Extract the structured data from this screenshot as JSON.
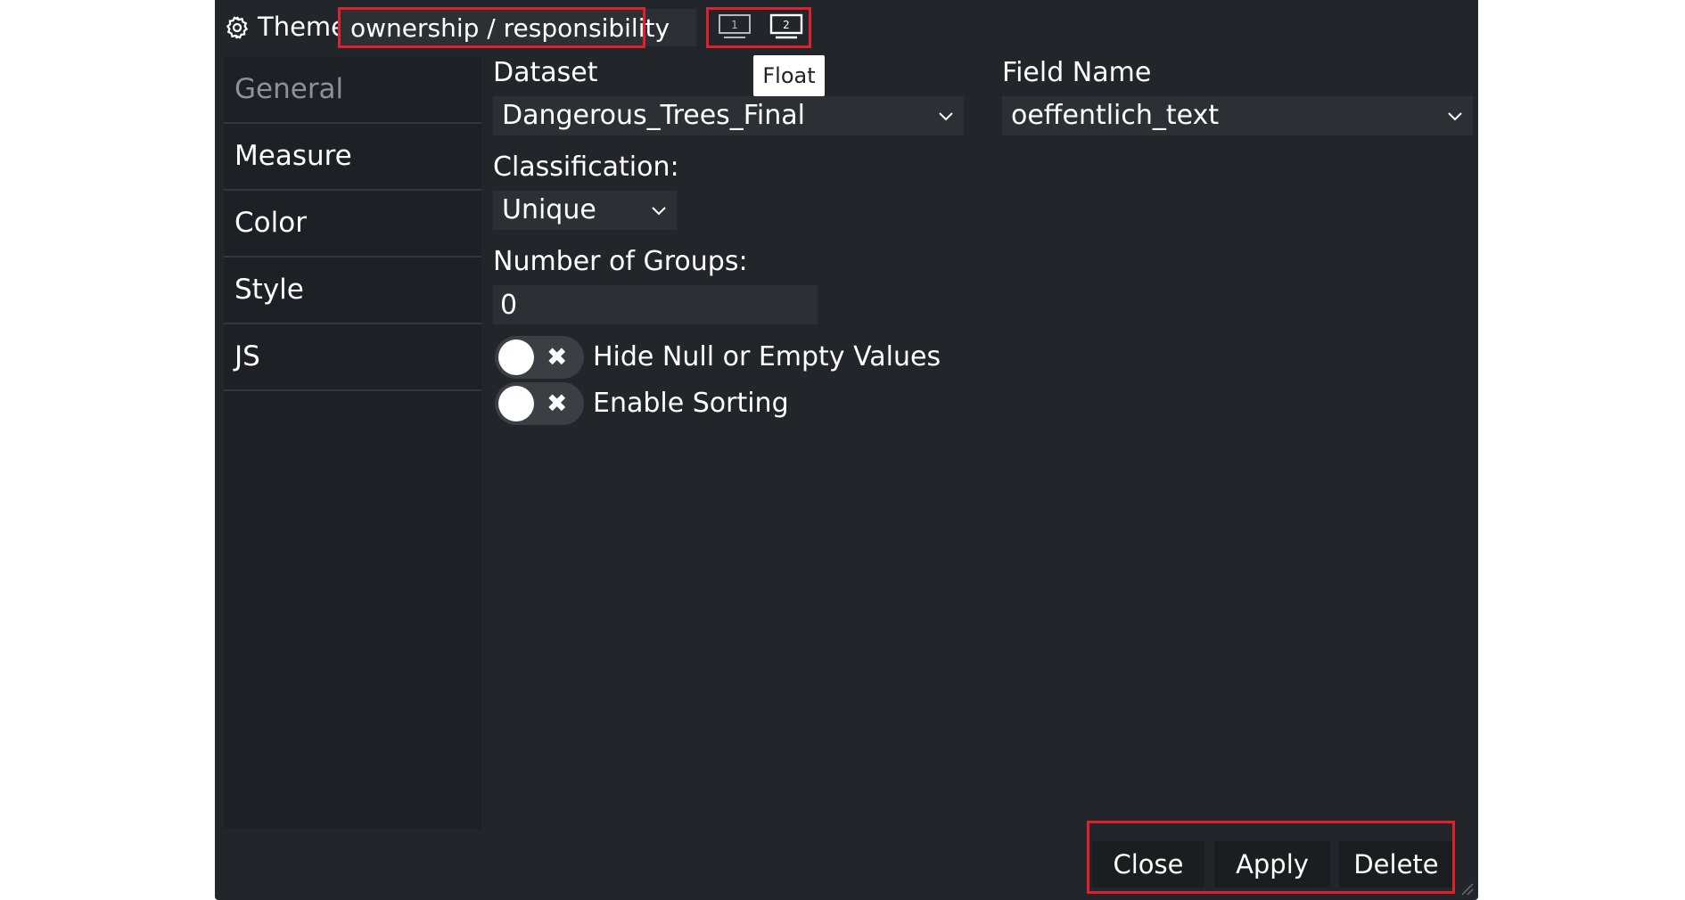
{
  "header": {
    "theme_label": "Theme",
    "theme_name_value": "ownership / responsibility",
    "monitor_1_label": "1",
    "monitor_2_label": "2",
    "tooltip": "Float"
  },
  "sidebar": {
    "items": [
      {
        "label": "General",
        "active": true
      },
      {
        "label": "Measure"
      },
      {
        "label": "Color"
      },
      {
        "label": "Style"
      },
      {
        "label": "JS"
      }
    ]
  },
  "form": {
    "dataset_label": "Dataset",
    "dataset_value": "Dangerous_Trees_Final",
    "field_name_label": "Field Name",
    "field_name_value": "oeffentlich_text",
    "classification_label": "Classification:",
    "classification_value": "Unique",
    "groups_label": "Number of Groups:",
    "groups_value": "0",
    "toggles": [
      {
        "label": "Hide Null or Empty Values",
        "on": false
      },
      {
        "label": "Enable Sorting",
        "on": false
      }
    ]
  },
  "footer": {
    "close_label": "Close",
    "apply_label": "Apply",
    "delete_label": "Delete"
  },
  "colors": {
    "background": "#222529",
    "sidebar": "#1d2024",
    "input": "#2c3035",
    "highlight": "#e0202c"
  }
}
